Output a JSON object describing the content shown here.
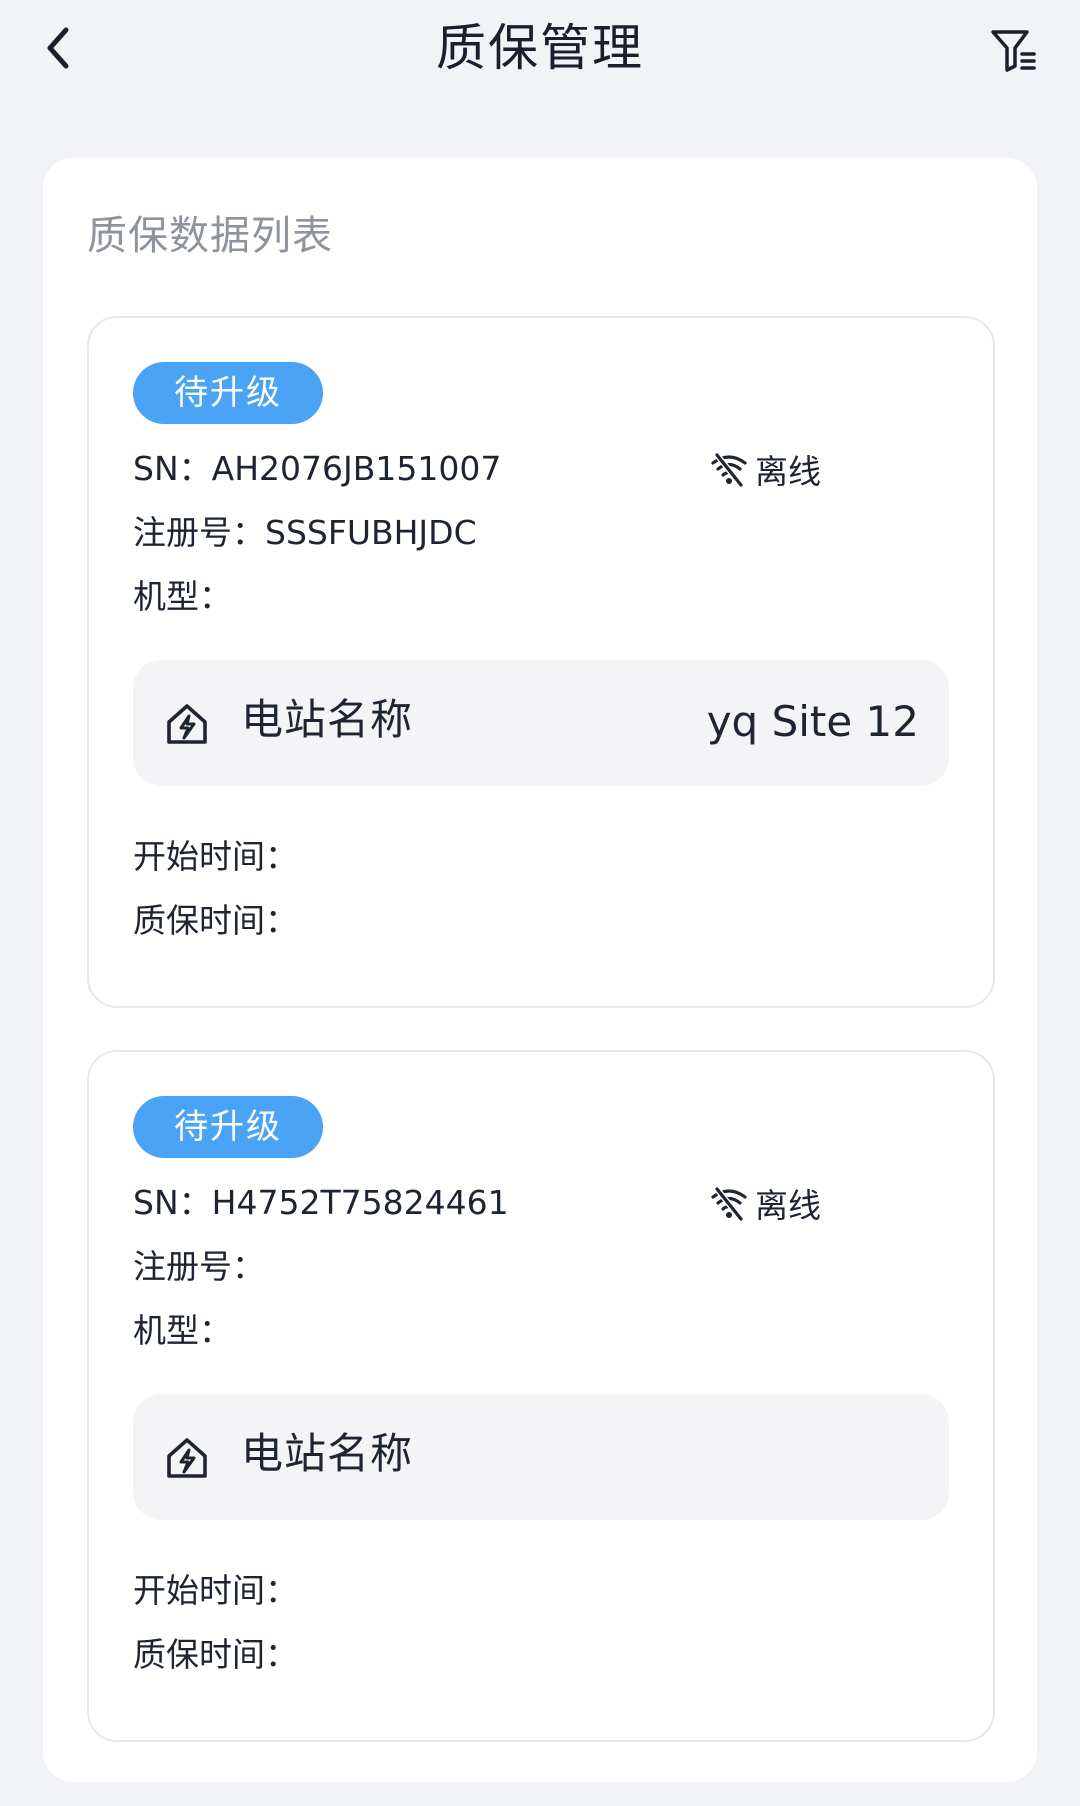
{
  "header": {
    "title": "质保管理",
    "back_icon": "chevron-left-icon",
    "filter_icon": "filter-list-icon"
  },
  "list": {
    "title": "质保数据列表"
  },
  "colors": {
    "background": "#f2f3f7",
    "tag": "#4aa3f5",
    "station_box": "#f4f4f6",
    "muted_text": "#8e939e"
  },
  "cards": [
    {
      "status_tag": "待升级",
      "sn_label": "SN：",
      "sn_value": "AH2076JB151007",
      "connection": "离线",
      "connection_icon": "wifi-off-icon",
      "reg_label": "注册号：",
      "reg_value": "SSSFUBHJDC",
      "model_label": "机型：",
      "model_value": "",
      "station_icon": "power-station-icon",
      "station_label": "电站名称",
      "station_value": "yq Site 12",
      "start_label": "开始时间：",
      "start_value": "",
      "warranty_label": "质保时间：",
      "warranty_value": ""
    },
    {
      "status_tag": "待升级",
      "sn_label": "SN：",
      "sn_value": "H4752T75824461",
      "connection": "离线",
      "connection_icon": "wifi-off-icon",
      "reg_label": "注册号：",
      "reg_value": "",
      "model_label": "机型：",
      "model_value": "",
      "station_icon": "power-station-icon",
      "station_label": "电站名称",
      "station_value": "",
      "start_label": "开始时间：",
      "start_value": "",
      "warranty_label": "质保时间：",
      "warranty_value": ""
    }
  ]
}
